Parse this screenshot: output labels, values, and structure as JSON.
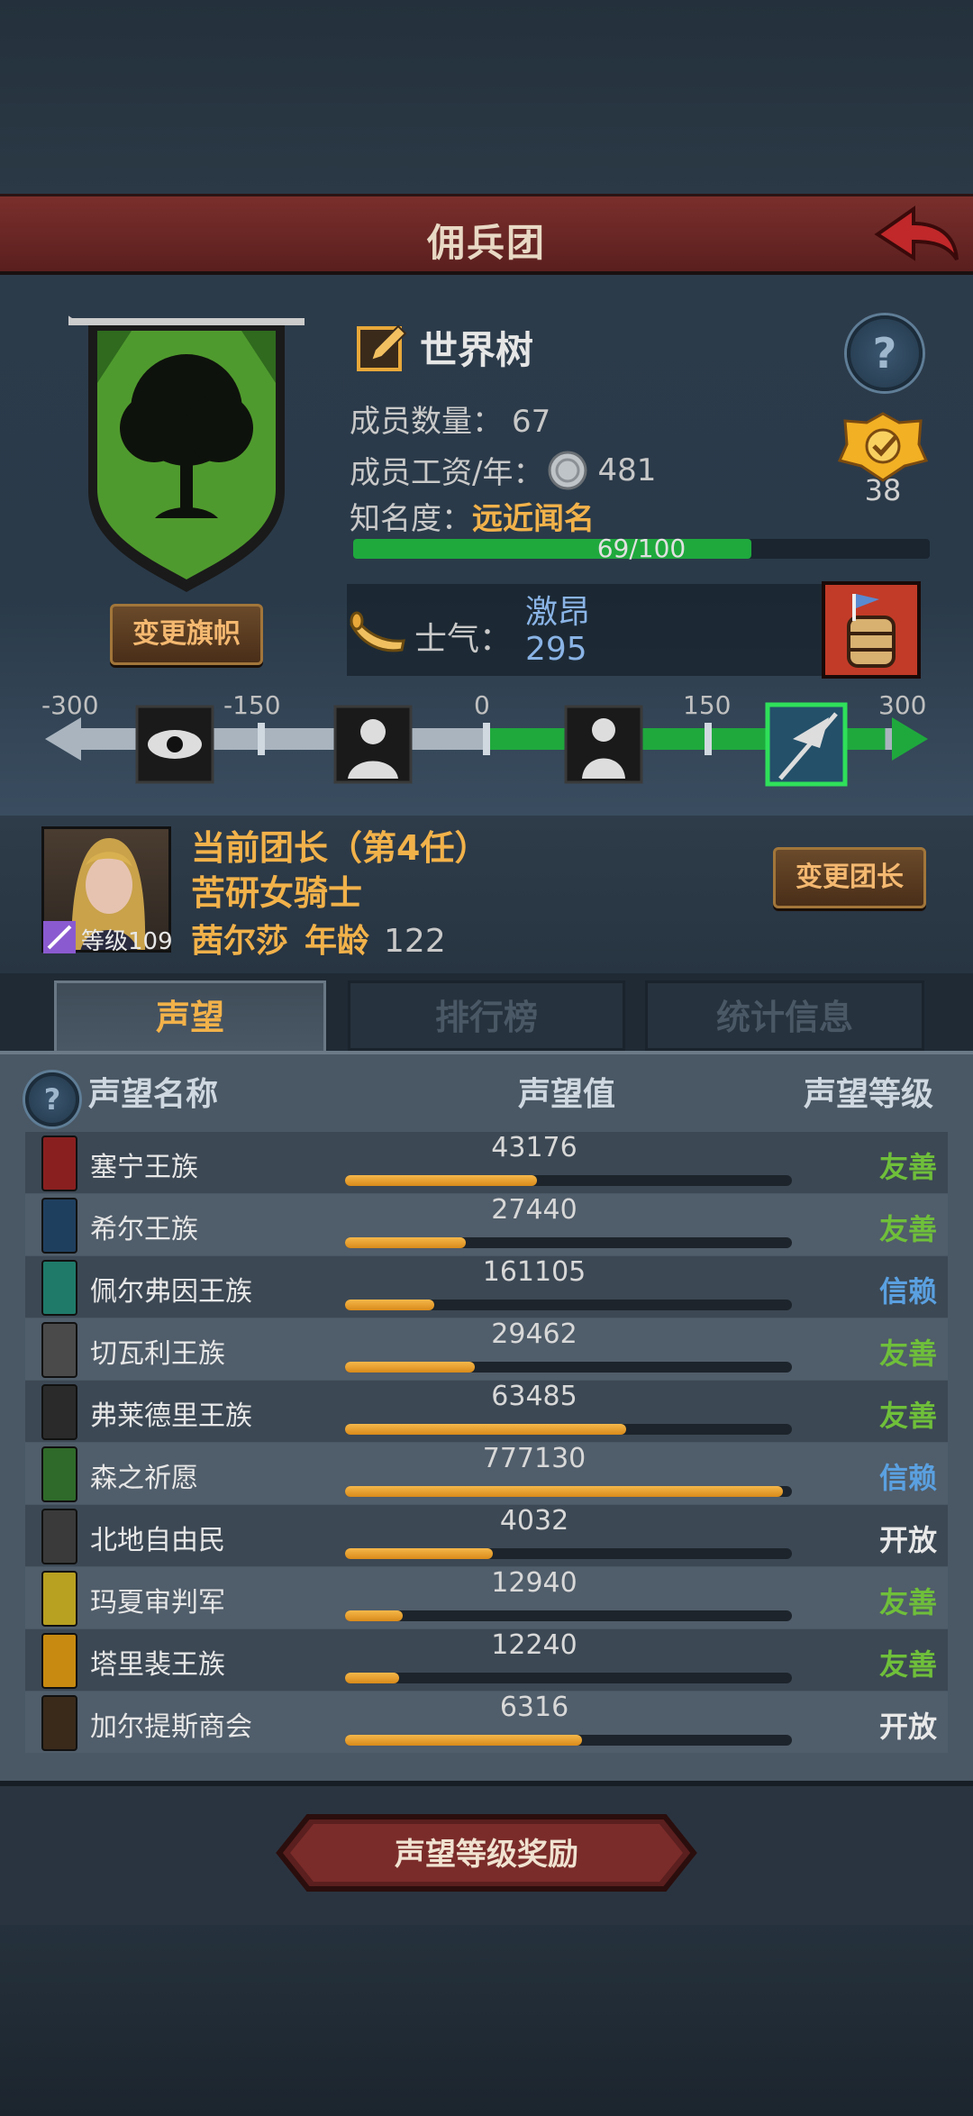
{
  "header": {
    "title": "佣兵团"
  },
  "guild": {
    "name": "世界树",
    "member_count_label": "成员数量：",
    "member_count": "67",
    "wage_label": "成员工资/年：",
    "wage": "481",
    "fame_label": "知名度：",
    "fame_value": "远近闻名",
    "fame_progress_text": "69/100",
    "fame_progress": 0.69,
    "badge_count": "38",
    "change_banner_label": "变更旗帜",
    "morale_label": "士气：",
    "morale_name": "激昂",
    "morale_value": "295"
  },
  "morale_scale": {
    "ticks": [
      "-300",
      "-150",
      "0",
      "150",
      "300"
    ],
    "value": 295,
    "min": -300,
    "max": 300
  },
  "leader": {
    "title": "当前团长（第4任）",
    "class": "苦研女骑士",
    "name": "茜尔莎",
    "age_label": "年龄",
    "age": "122",
    "level_label": "等级109",
    "change_leader_label": "变更团长"
  },
  "tabs": [
    {
      "label": "声望",
      "active": true
    },
    {
      "label": "排行榜",
      "active": false
    },
    {
      "label": "统计信息",
      "active": false
    }
  ],
  "reputation": {
    "headers": {
      "name": "声望名称",
      "value": "声望值",
      "level": "声望等级"
    },
    "rows": [
      {
        "name": "塞宁王族",
        "value": "43176",
        "level": "友善",
        "fill": 0.43,
        "color": "#6fbf3a",
        "icon_bg": "#8a1f1f"
      },
      {
        "name": "希尔王族",
        "value": "27440",
        "level": "友善",
        "fill": 0.27,
        "color": "#6fbf3a",
        "icon_bg": "#1f3f5f"
      },
      {
        "name": "佩尔弗因王族",
        "value": "161105",
        "level": "信赖",
        "fill": 0.2,
        "color": "#5aa0e0",
        "icon_bg": "#1f7a6a"
      },
      {
        "name": "切瓦利王族",
        "value": "29462",
        "level": "友善",
        "fill": 0.29,
        "color": "#6fbf3a",
        "icon_bg": "#4a4a4a"
      },
      {
        "name": "弗莱德里王族",
        "value": "63485",
        "level": "友善",
        "fill": 0.63,
        "color": "#6fbf3a",
        "icon_bg": "#2a2a2a"
      },
      {
        "name": "森之祈愿",
        "value": "777130",
        "level": "信赖",
        "fill": 0.98,
        "color": "#5aa0e0",
        "icon_bg": "#2f6a2a"
      },
      {
        "name": "北地自由民",
        "value": "4032",
        "level": "开放",
        "fill": 0.33,
        "color": "#e8e8e8",
        "icon_bg": "#3a3a3a"
      },
      {
        "name": "玛夏审判军",
        "value": "12940",
        "level": "友善",
        "fill": 0.13,
        "color": "#6fbf3a",
        "icon_bg": "#b8a020"
      },
      {
        "name": "塔里裴王族",
        "value": "12240",
        "level": "友善",
        "fill": 0.12,
        "color": "#6fbf3a",
        "icon_bg": "#c88a10"
      },
      {
        "name": "加尔提斯商会",
        "value": "6316",
        "level": "开放",
        "fill": 0.53,
        "color": "#e8e8e8",
        "icon_bg": "#3a2a1a"
      }
    ]
  },
  "footer": {
    "reward_button": "声望等级奖励"
  },
  "colors": {
    "accent_gold": "#f2b24a",
    "morale_green": "#1fa93d",
    "title_red": "#6e2a28"
  }
}
